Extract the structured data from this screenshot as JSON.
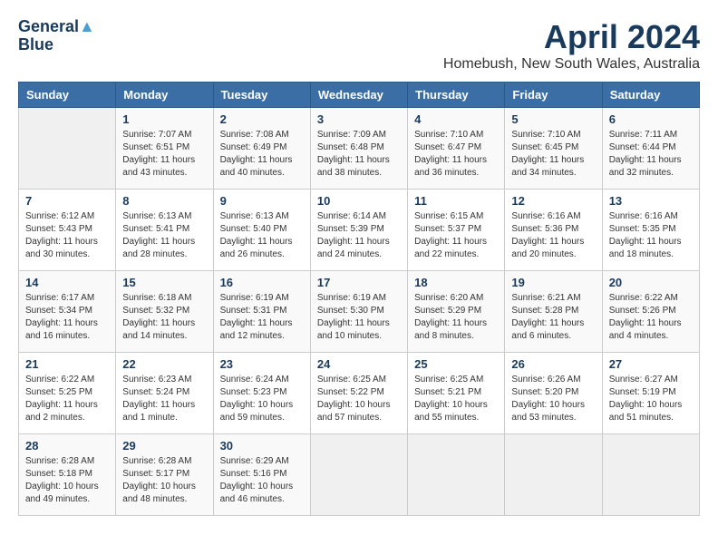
{
  "header": {
    "logo_line1": "General",
    "logo_line2": "Blue",
    "title": "April 2024",
    "subtitle": "Homebush, New South Wales, Australia"
  },
  "days_of_week": [
    "Sunday",
    "Monday",
    "Tuesday",
    "Wednesday",
    "Thursday",
    "Friday",
    "Saturday"
  ],
  "weeks": [
    [
      {
        "day": "",
        "info": ""
      },
      {
        "day": "1",
        "info": "Sunrise: 7:07 AM\nSunset: 6:51 PM\nDaylight: 11 hours\nand 43 minutes."
      },
      {
        "day": "2",
        "info": "Sunrise: 7:08 AM\nSunset: 6:49 PM\nDaylight: 11 hours\nand 40 minutes."
      },
      {
        "day": "3",
        "info": "Sunrise: 7:09 AM\nSunset: 6:48 PM\nDaylight: 11 hours\nand 38 minutes."
      },
      {
        "day": "4",
        "info": "Sunrise: 7:10 AM\nSunset: 6:47 PM\nDaylight: 11 hours\nand 36 minutes."
      },
      {
        "day": "5",
        "info": "Sunrise: 7:10 AM\nSunset: 6:45 PM\nDaylight: 11 hours\nand 34 minutes."
      },
      {
        "day": "6",
        "info": "Sunrise: 7:11 AM\nSunset: 6:44 PM\nDaylight: 11 hours\nand 32 minutes."
      }
    ],
    [
      {
        "day": "7",
        "info": "Sunrise: 6:12 AM\nSunset: 5:43 PM\nDaylight: 11 hours\nand 30 minutes."
      },
      {
        "day": "8",
        "info": "Sunrise: 6:13 AM\nSunset: 5:41 PM\nDaylight: 11 hours\nand 28 minutes."
      },
      {
        "day": "9",
        "info": "Sunrise: 6:13 AM\nSunset: 5:40 PM\nDaylight: 11 hours\nand 26 minutes."
      },
      {
        "day": "10",
        "info": "Sunrise: 6:14 AM\nSunset: 5:39 PM\nDaylight: 11 hours\nand 24 minutes."
      },
      {
        "day": "11",
        "info": "Sunrise: 6:15 AM\nSunset: 5:37 PM\nDaylight: 11 hours\nand 22 minutes."
      },
      {
        "day": "12",
        "info": "Sunrise: 6:16 AM\nSunset: 5:36 PM\nDaylight: 11 hours\nand 20 minutes."
      },
      {
        "day": "13",
        "info": "Sunrise: 6:16 AM\nSunset: 5:35 PM\nDaylight: 11 hours\nand 18 minutes."
      }
    ],
    [
      {
        "day": "14",
        "info": "Sunrise: 6:17 AM\nSunset: 5:34 PM\nDaylight: 11 hours\nand 16 minutes."
      },
      {
        "day": "15",
        "info": "Sunrise: 6:18 AM\nSunset: 5:32 PM\nDaylight: 11 hours\nand 14 minutes."
      },
      {
        "day": "16",
        "info": "Sunrise: 6:19 AM\nSunset: 5:31 PM\nDaylight: 11 hours\nand 12 minutes."
      },
      {
        "day": "17",
        "info": "Sunrise: 6:19 AM\nSunset: 5:30 PM\nDaylight: 11 hours\nand 10 minutes."
      },
      {
        "day": "18",
        "info": "Sunrise: 6:20 AM\nSunset: 5:29 PM\nDaylight: 11 hours\nand 8 minutes."
      },
      {
        "day": "19",
        "info": "Sunrise: 6:21 AM\nSunset: 5:28 PM\nDaylight: 11 hours\nand 6 minutes."
      },
      {
        "day": "20",
        "info": "Sunrise: 6:22 AM\nSunset: 5:26 PM\nDaylight: 11 hours\nand 4 minutes."
      }
    ],
    [
      {
        "day": "21",
        "info": "Sunrise: 6:22 AM\nSunset: 5:25 PM\nDaylight: 11 hours\nand 2 minutes."
      },
      {
        "day": "22",
        "info": "Sunrise: 6:23 AM\nSunset: 5:24 PM\nDaylight: 11 hours\nand 1 minute."
      },
      {
        "day": "23",
        "info": "Sunrise: 6:24 AM\nSunset: 5:23 PM\nDaylight: 10 hours\nand 59 minutes."
      },
      {
        "day": "24",
        "info": "Sunrise: 6:25 AM\nSunset: 5:22 PM\nDaylight: 10 hours\nand 57 minutes."
      },
      {
        "day": "25",
        "info": "Sunrise: 6:25 AM\nSunset: 5:21 PM\nDaylight: 10 hours\nand 55 minutes."
      },
      {
        "day": "26",
        "info": "Sunrise: 6:26 AM\nSunset: 5:20 PM\nDaylight: 10 hours\nand 53 minutes."
      },
      {
        "day": "27",
        "info": "Sunrise: 6:27 AM\nSunset: 5:19 PM\nDaylight: 10 hours\nand 51 minutes."
      }
    ],
    [
      {
        "day": "28",
        "info": "Sunrise: 6:28 AM\nSunset: 5:18 PM\nDaylight: 10 hours\nand 49 minutes."
      },
      {
        "day": "29",
        "info": "Sunrise: 6:28 AM\nSunset: 5:17 PM\nDaylight: 10 hours\nand 48 minutes."
      },
      {
        "day": "30",
        "info": "Sunrise: 6:29 AM\nSunset: 5:16 PM\nDaylight: 10 hours\nand 46 minutes."
      },
      {
        "day": "",
        "info": ""
      },
      {
        "day": "",
        "info": ""
      },
      {
        "day": "",
        "info": ""
      },
      {
        "day": "",
        "info": ""
      }
    ]
  ]
}
